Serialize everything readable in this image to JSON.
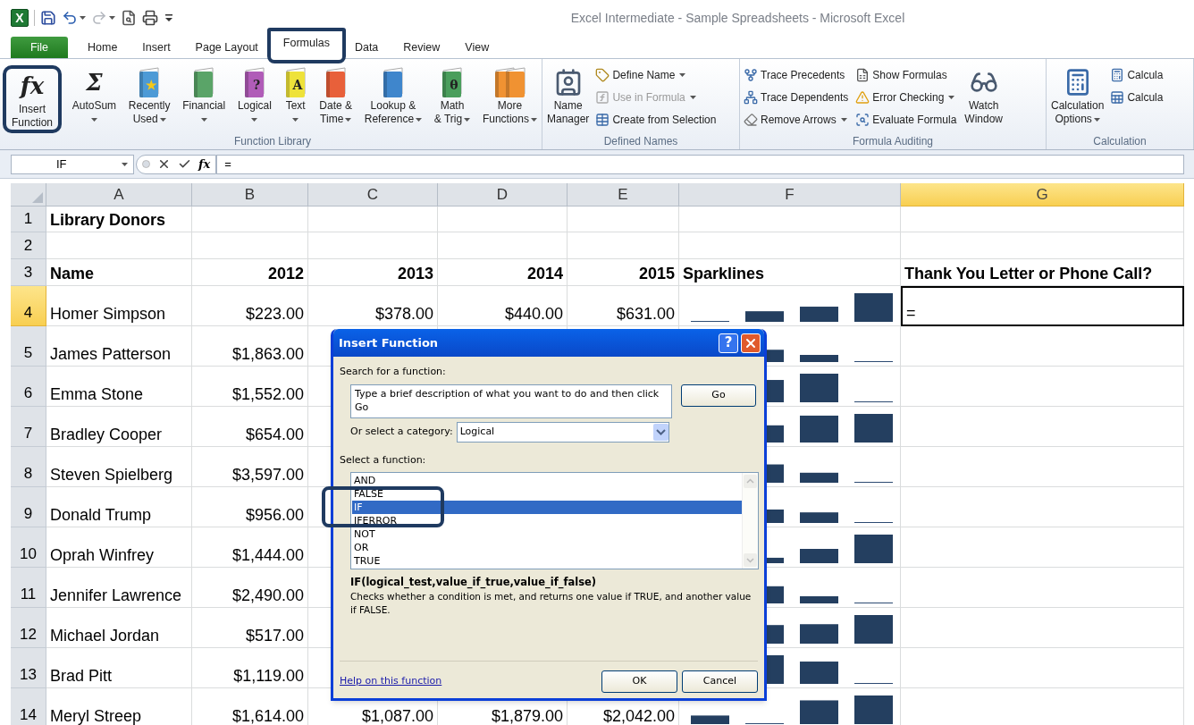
{
  "window": {
    "title": "Excel Intermediate - Sample Spreadsheets - Microsoft Excel"
  },
  "quick_access": {
    "logo": "X",
    "items": [
      {
        "kind": "save",
        "dropdown": false,
        "disabled": false
      },
      {
        "kind": "undo",
        "dropdown": true,
        "disabled": false
      },
      {
        "kind": "redo",
        "dropdown": true,
        "disabled": true
      },
      {
        "kind": "preview",
        "dropdown": false,
        "disabled": false
      },
      {
        "kind": "print",
        "dropdown": false,
        "disabled": false
      },
      {
        "kind": "customize",
        "dropdown": false,
        "disabled": false
      }
    ]
  },
  "tabs": [
    {
      "label": "File",
      "kind": "file",
      "selected": false,
      "highlighted": false
    },
    {
      "label": "Home",
      "kind": "tab",
      "selected": false,
      "highlighted": false
    },
    {
      "label": "Insert",
      "kind": "tab",
      "selected": false,
      "highlighted": false
    },
    {
      "label": "Page Layout",
      "kind": "tab",
      "selected": false,
      "highlighted": false
    },
    {
      "label": "Formulas",
      "kind": "tab",
      "selected": true,
      "highlighted": true
    },
    {
      "label": "Data",
      "kind": "tab",
      "selected": false,
      "highlighted": false
    },
    {
      "label": "Review",
      "kind": "tab",
      "selected": false,
      "highlighted": false
    },
    {
      "label": "View",
      "kind": "tab",
      "selected": false,
      "highlighted": false
    }
  ],
  "ribbon": [
    {
      "label": "Function Library",
      "items": [
        {
          "kind": "glyph",
          "glyph": "fx",
          "lines": [
            "Insert",
            "Function"
          ],
          "dropdown": false,
          "highlighted": true
        },
        {
          "kind": "glyph",
          "glyph": "Σ",
          "lines": [
            "AutoSum"
          ],
          "dropdown": true,
          "highlighted": false
        },
        {
          "kind": "book",
          "color": "#4d9ad6",
          "glyph": "★",
          "lines": [
            "Recently",
            "Used"
          ],
          "dropdown": true,
          "highlighted": false
        },
        {
          "kind": "book",
          "color": "#5aa468",
          "lines": [
            "Financial"
          ],
          "dropdown": true,
          "highlighted": false
        },
        {
          "kind": "book",
          "color": "#b05cb8",
          "glyph": "?",
          "lines": [
            "Logical"
          ],
          "dropdown": true,
          "highlighted": false
        },
        {
          "kind": "book",
          "color": "#eee23a",
          "glyph": "A",
          "lines": [
            "Text"
          ],
          "dropdown": true,
          "highlighted": false
        },
        {
          "kind": "book",
          "color": "#e8603a",
          "lines": [
            "Date &",
            "Time"
          ],
          "dropdown": true,
          "highlighted": false
        },
        {
          "kind": "book",
          "color": "#3f86cc",
          "lines": [
            "Lookup &",
            "Reference"
          ],
          "dropdown": true,
          "highlighted": false
        },
        {
          "kind": "book",
          "color": "#4a9e5c",
          "glyph": "θ",
          "lines": [
            "Math",
            "& Trig"
          ],
          "dropdown": true,
          "highlighted": false
        },
        {
          "kind": "books",
          "color": "#f09232",
          "lines": [
            "More",
            "Functions"
          ],
          "dropdown": true,
          "highlighted": false
        }
      ]
    },
    {
      "label": "Defined Names",
      "items": [
        {
          "kind": "name-manager",
          "lines": [
            "Name",
            "Manager"
          ],
          "dropdown": false,
          "highlighted": false
        },
        {
          "kind": "stack",
          "highlighted": false,
          "items": [
            {
              "kind": "define",
              "label": "Define Name",
              "dropdown": true,
              "disabled": false
            },
            {
              "kind": "use",
              "label": "Use in Formula",
              "dropdown": true,
              "disabled": true
            },
            {
              "kind": "create",
              "label": "Create from Selection",
              "dropdown": false,
              "disabled": false
            }
          ]
        }
      ]
    },
    {
      "label": "Formula Auditing",
      "items": [
        {
          "kind": "stack",
          "highlighted": false,
          "items": [
            {
              "kind": "precedents",
              "label": "Trace Precedents",
              "dropdown": false,
              "disabled": false
            },
            {
              "kind": "dependents",
              "label": "Trace Dependents",
              "dropdown": false,
              "disabled": false
            },
            {
              "kind": "remove",
              "label": "Remove Arrows",
              "dropdown": true,
              "disabled": false
            }
          ]
        },
        {
          "kind": "stack",
          "highlighted": false,
          "items": [
            {
              "kind": "show",
              "label": "Show Formulas",
              "dropdown": false,
              "disabled": false
            },
            {
              "kind": "error",
              "label": "Error Checking",
              "dropdown": true,
              "disabled": false
            },
            {
              "kind": "evaluate",
              "label": "Evaluate Formula",
              "dropdown": false,
              "disabled": false
            }
          ]
        },
        {
          "kind": "watch",
          "lines": [
            "Watch",
            "Window"
          ],
          "dropdown": false,
          "highlighted": false
        }
      ]
    },
    {
      "label": "Calculation",
      "items": [
        {
          "kind": "calc-options",
          "lines": [
            "Calculation",
            "Options"
          ],
          "dropdown": true,
          "highlighted": false
        },
        {
          "kind": "stack",
          "highlighted": false,
          "items": [
            {
              "kind": "calc-now",
              "label": "Calcula",
              "dropdown": false,
              "disabled": false
            },
            {
              "kind": "calc-sheet",
              "label": "Calcula",
              "dropdown": false,
              "disabled": false
            }
          ]
        }
      ]
    }
  ],
  "formula_bar": {
    "name_box": "IF",
    "fx": "fx",
    "formula": "="
  },
  "columns": [
    {
      "label": "A",
      "selected": false
    },
    {
      "label": "B",
      "selected": false
    },
    {
      "label": "C",
      "selected": false
    },
    {
      "label": "D",
      "selected": false
    },
    {
      "label": "E",
      "selected": false
    },
    {
      "label": "F",
      "selected": false
    },
    {
      "label": "G",
      "selected": true
    }
  ],
  "rows": [
    {
      "number": "1",
      "kind": "title",
      "selected": false,
      "cells": {
        "A": "Library Donors"
      }
    },
    {
      "number": "2",
      "kind": "blank",
      "selected": false
    },
    {
      "number": "3",
      "kind": "header",
      "selected": false,
      "cells": {
        "A": "Name",
        "B": "2012",
        "C": "2013",
        "D": "2014",
        "E": "2015",
        "F": "Sparklines",
        "G": "Thank You Letter or Phone Call?"
      }
    },
    {
      "number": "4",
      "kind": "data",
      "selected": true,
      "cells": {
        "A": "Homer Simpson",
        "B": "$223.00",
        "C": "$378.00",
        "D": "$440.00",
        "E": "$631.00",
        "G": "="
      }
    },
    {
      "number": "5",
      "kind": "data",
      "selected": false,
      "cells": {
        "A": "James Patterson",
        "B": "$1,863.00"
      }
    },
    {
      "number": "6",
      "kind": "data",
      "selected": false,
      "cells": {
        "A": "Emma Stone",
        "B": "$1,552.00"
      }
    },
    {
      "number": "7",
      "kind": "data",
      "selected": false,
      "cells": {
        "A": "Bradley Cooper",
        "B": "$654.00"
      }
    },
    {
      "number": "8",
      "kind": "data",
      "selected": false,
      "cells": {
        "A": "Steven Spielberg",
        "B": "$3,597.00"
      }
    },
    {
      "number": "9",
      "kind": "data",
      "selected": false,
      "cells": {
        "A": "Donald Trump",
        "B": "$956.00"
      }
    },
    {
      "number": "10",
      "kind": "data",
      "selected": false,
      "cells": {
        "A": "Oprah Winfrey",
        "B": "$1,444.00"
      }
    },
    {
      "number": "11",
      "kind": "data",
      "selected": false,
      "cells": {
        "A": "Jennifer Lawrence",
        "B": "$2,490.00"
      }
    },
    {
      "number": "12",
      "kind": "data",
      "selected": false,
      "cells": {
        "A": "Michael Jordan",
        "B": "$517.00"
      }
    },
    {
      "number": "13",
      "kind": "data",
      "selected": false,
      "cells": {
        "A": "Brad Pitt",
        "B": "$1,119.00"
      }
    },
    {
      "number": "14",
      "kind": "data",
      "selected": false,
      "cells": {
        "A": "Meryl Streep",
        "B": "$1,614.00",
        "C": "$1,087.00",
        "D": "$1,879.00",
        "E": "$2,042.00"
      }
    }
  ],
  "dialog": {
    "title": "Insert Function",
    "help": "?",
    "search_label": "Search for a function:",
    "search": {
      "value": "Type a brief description of what you want to do and then click Go"
    },
    "go": "Go",
    "category_label": "Or select a category:",
    "category": {
      "value": "Logical"
    },
    "list_label": "Select a function:",
    "functions": [
      {
        "label": "AND",
        "selected": false,
        "highlighted": false
      },
      {
        "label": "FALSE",
        "selected": false,
        "highlighted": false
      },
      {
        "label": "IF",
        "selected": true,
        "highlighted": true
      },
      {
        "label": "IFERROR",
        "selected": false,
        "highlighted": false
      },
      {
        "label": "NOT",
        "selected": false,
        "highlighted": false
      },
      {
        "label": "OR",
        "selected": false,
        "highlighted": false
      },
      {
        "label": "TRUE",
        "selected": false,
        "highlighted": false
      }
    ],
    "signature": "IF(logical_test,value_if_true,value_if_false)",
    "description": "Checks whether a condition is met, and returns one value if TRUE, and another value if FALSE.",
    "help_link": "Help on this function",
    "buttons": [
      "OK",
      "Cancel"
    ]
  }
}
